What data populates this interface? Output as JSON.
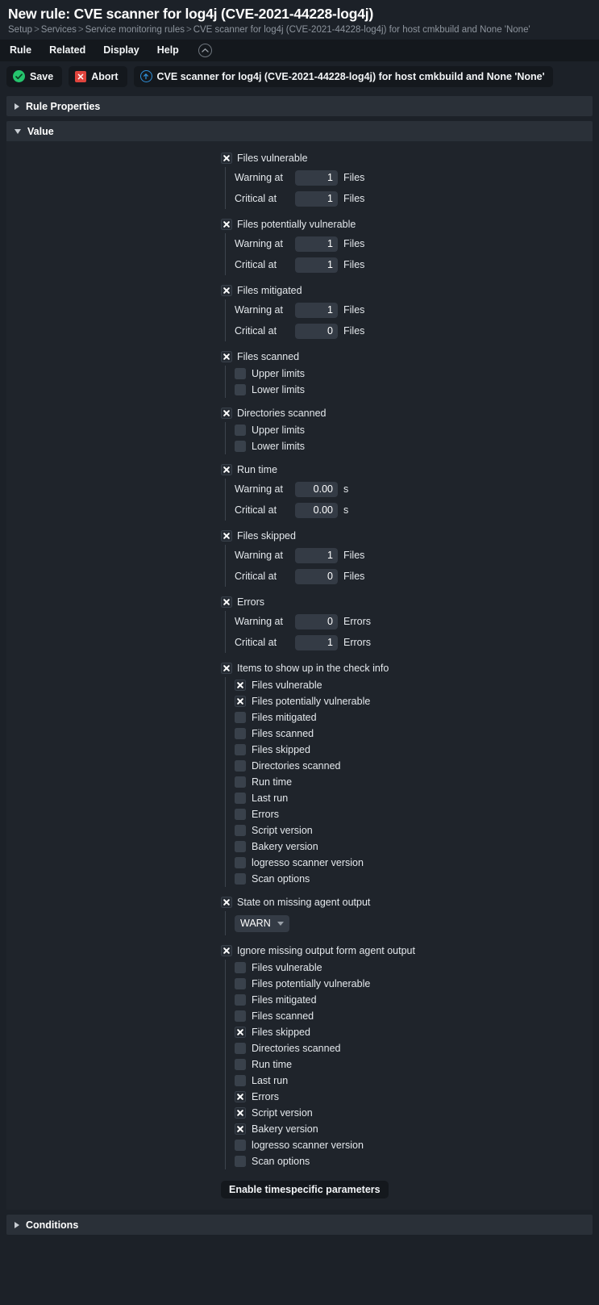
{
  "header": {
    "title": "New rule: CVE scanner for log4j (CVE-2021-44228-log4j)",
    "breadcrumb": [
      "Setup",
      "Services",
      "Service monitoring rules",
      "CVE scanner for log4j (CVE-2021-44228-log4j) for host cmkbuild and None 'None'"
    ]
  },
  "menubar": {
    "items": [
      "Rule",
      "Related",
      "Display",
      "Help"
    ],
    "collapse_icon": "chevron-up-circle-icon"
  },
  "actionbar": {
    "save_label": "Save",
    "abort_label": "Abort",
    "context_label": "CVE scanner for log4j (CVE-2021-44228-log4j) for host cmkbuild and None 'None'",
    "save_icon": "check-circle-icon",
    "abort_icon": "close-square-icon",
    "context_icon": "info-up-circle-icon"
  },
  "sections": {
    "rule_properties": {
      "title": "Rule Properties",
      "expanded": false
    },
    "value": {
      "title": "Value",
      "expanded": true
    },
    "conditions": {
      "title": "Conditions",
      "expanded": false
    }
  },
  "labels": {
    "warning_at": "Warning at",
    "critical_at": "Critical at",
    "unit_files": "Files",
    "unit_errors": "Errors",
    "unit_seconds": "s",
    "upper_limits": "Upper limits",
    "lower_limits": "Lower limits"
  },
  "value_groups": [
    {
      "label": "Files vulnerable",
      "checked": true,
      "kind": "levels",
      "warning": "1",
      "critical": "1",
      "unit": "Files"
    },
    {
      "label": "Files potentially vulnerable",
      "checked": true,
      "kind": "levels",
      "warning": "1",
      "critical": "1",
      "unit": "Files"
    },
    {
      "label": "Files mitigated",
      "checked": true,
      "kind": "levels",
      "warning": "1",
      "critical": "0",
      "unit": "Files"
    },
    {
      "label": "Files scanned",
      "checked": true,
      "kind": "limits",
      "upper_checked": false,
      "lower_checked": false
    },
    {
      "label": "Directories scanned",
      "checked": true,
      "kind": "limits",
      "upper_checked": false,
      "lower_checked": false
    },
    {
      "label": "Run time",
      "checked": true,
      "kind": "levels",
      "warning": "0.00",
      "critical": "0.00",
      "unit": "s"
    },
    {
      "label": "Files skipped",
      "checked": true,
      "kind": "levels",
      "warning": "1",
      "critical": "0",
      "unit": "Files"
    },
    {
      "label": "Errors",
      "checked": true,
      "kind": "levels",
      "warning": "0",
      "critical": "1",
      "unit": "Errors"
    }
  ],
  "check_info": {
    "label": "Items to show up in the check info",
    "checked": true,
    "options": [
      {
        "label": "Files vulnerable",
        "checked": true
      },
      {
        "label": "Files potentially vulnerable",
        "checked": true
      },
      {
        "label": "Files mitigated",
        "checked": false
      },
      {
        "label": "Files scanned",
        "checked": false
      },
      {
        "label": "Files skipped",
        "checked": false
      },
      {
        "label": "Directories scanned",
        "checked": false
      },
      {
        "label": "Run time",
        "checked": false
      },
      {
        "label": "Last run",
        "checked": false
      },
      {
        "label": "Errors",
        "checked": false
      },
      {
        "label": "Script version",
        "checked": false
      },
      {
        "label": "Bakery version",
        "checked": false
      },
      {
        "label": "logresso scanner version",
        "checked": false
      },
      {
        "label": "Scan options",
        "checked": false
      }
    ]
  },
  "missing_state": {
    "label": "State on missing agent output",
    "checked": true,
    "value": "WARN"
  },
  "ignore_missing": {
    "label": "Ignore missing output form agent output",
    "checked": true,
    "options": [
      {
        "label": "Files vulnerable",
        "checked": false
      },
      {
        "label": "Files potentially vulnerable",
        "checked": false
      },
      {
        "label": "Files mitigated",
        "checked": false
      },
      {
        "label": "Files scanned",
        "checked": false
      },
      {
        "label": "Files skipped",
        "checked": true
      },
      {
        "label": "Directories scanned",
        "checked": false
      },
      {
        "label": "Run time",
        "checked": false
      },
      {
        "label": "Last run",
        "checked": false
      },
      {
        "label": "Errors",
        "checked": true
      },
      {
        "label": "Script version",
        "checked": true
      },
      {
        "label": "Bakery version",
        "checked": true
      },
      {
        "label": "logresso scanner version",
        "checked": false
      },
      {
        "label": "Scan options",
        "checked": false
      }
    ]
  },
  "timespecific": {
    "label": "Enable timespecific parameters"
  }
}
